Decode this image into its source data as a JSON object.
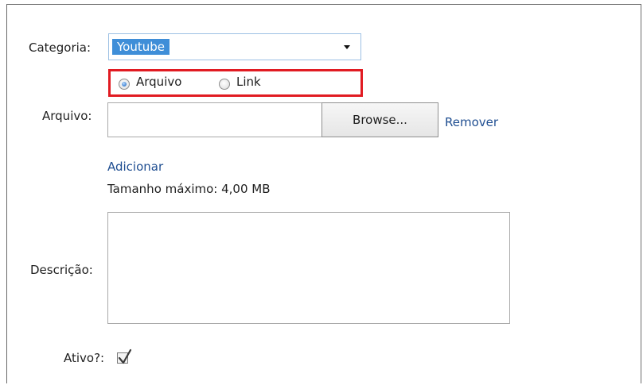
{
  "form": {
    "categoria_label": "Categoria:",
    "categoria_value": "Youtube",
    "radio_options": [
      {
        "label": "Arquivo",
        "checked": true
      },
      {
        "label": "Link",
        "checked": false
      }
    ],
    "arquivo_label": "Arquivo:",
    "browse_label": "Browse...",
    "remover_label": "Remover",
    "adicionar_label": "Adicionar",
    "tamanho_text": "Tamanho máximo: 4,00 MB",
    "descricao_label": "Descrição:",
    "ativo_label": "Ativo?:",
    "ativo_checked": true
  },
  "colors": {
    "highlight_border": "#e11b22",
    "selection": "#3f8ed8",
    "link": "#1f4e91"
  }
}
